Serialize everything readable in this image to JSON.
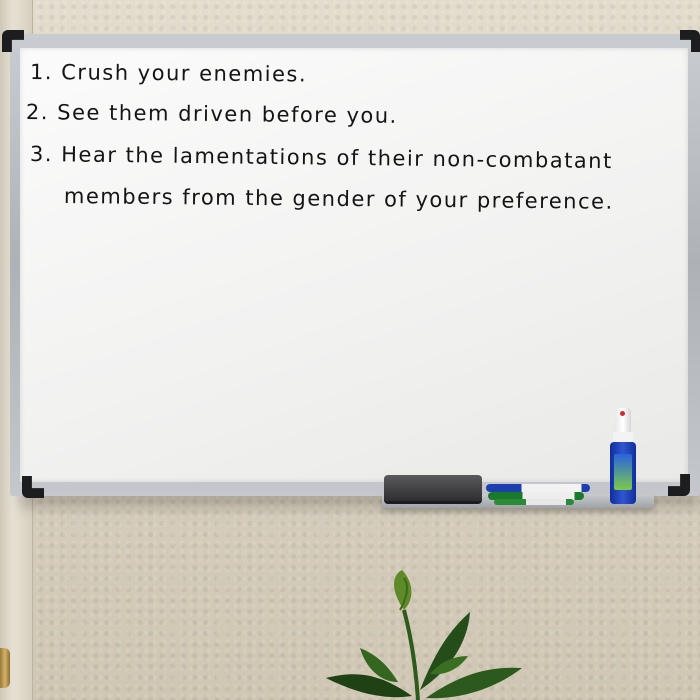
{
  "whiteboard": {
    "lines": [
      "1. Crush  your  enemies.",
      "2. See   them  driven  before  you.",
      "3. Hear  the  lamentations  of  their   non-combatant",
      "members  from  the  gender  of  your  preference."
    ]
  },
  "colors": {
    "ink": "#141414",
    "board": "#f4f4f3",
    "frame": "#b7bbc0",
    "wall": "#d9d2c3",
    "marker_blue": "#1d3fae",
    "marker_green": "#1a7a2c",
    "spray_bottle": "#1f45c0"
  },
  "icons": [
    "eraser-icon",
    "marker-icon",
    "spray-bottle-icon",
    "plant-icon"
  ]
}
